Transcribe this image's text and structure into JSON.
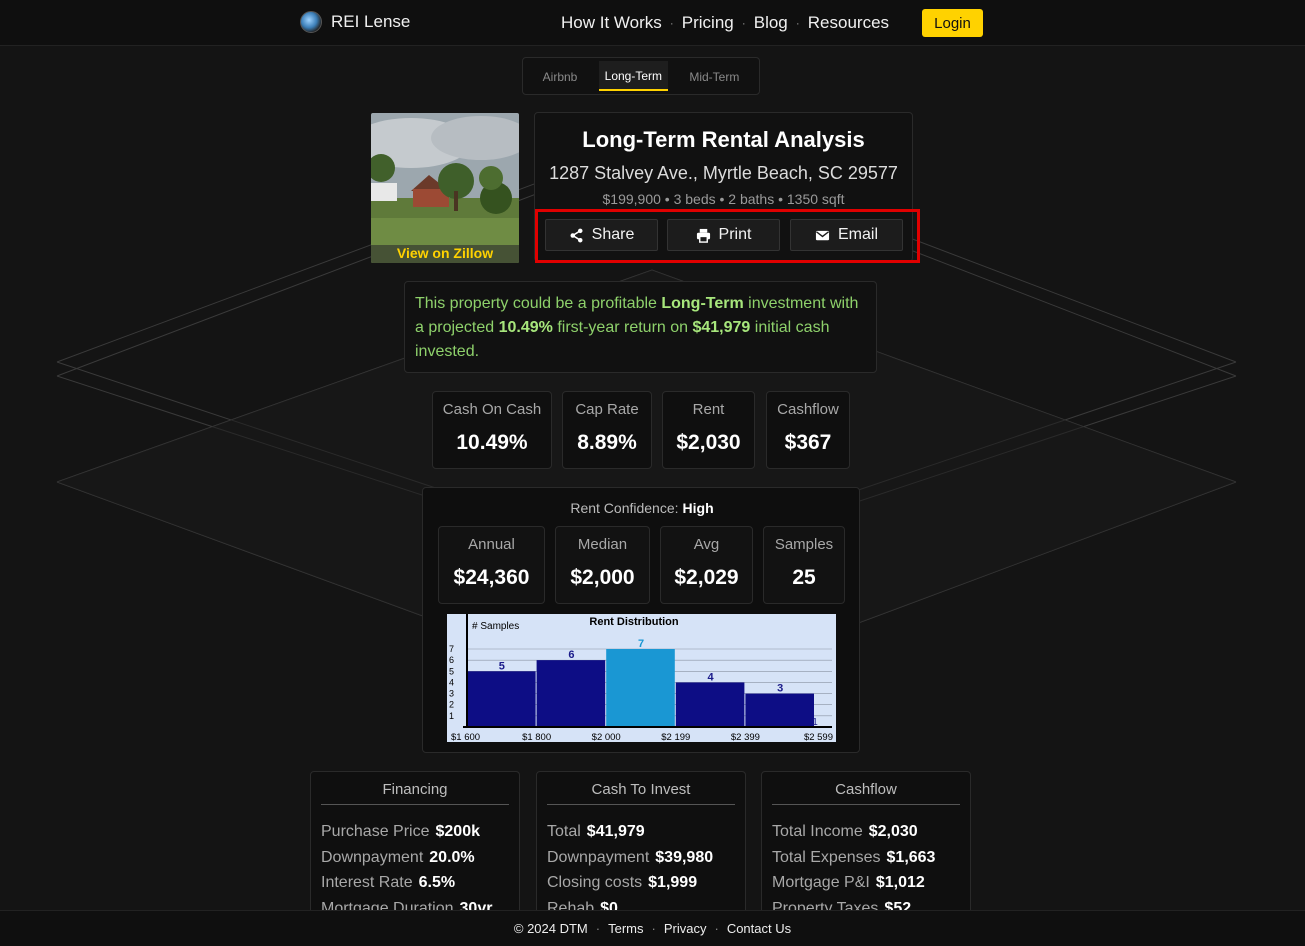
{
  "brand": {
    "name": "REI Lense"
  },
  "nav": {
    "items": [
      "How It Works",
      "Pricing",
      "Blog",
      "Resources"
    ],
    "separator": "·",
    "login_label": "Login"
  },
  "tabs": [
    {
      "label": "Airbnb",
      "active": false
    },
    {
      "label": "Long-Term",
      "active": true
    },
    {
      "label": "Mid-Term",
      "active": false
    }
  ],
  "property": {
    "zillow_link": "View on Zillow",
    "title": "Long-Term Rental Analysis",
    "address": "1287 Stalvey Ave., Myrtle Beach, SC 29577",
    "specs": "$199,900 • 3 beds • 2 baths • 1350 sqft"
  },
  "actions": {
    "share_label": "Share",
    "print_label": "Print",
    "email_label": "Email"
  },
  "summary": {
    "part1": "This property could be a profitable ",
    "strategy": "Long-Term",
    "part2": " investment with a projected ",
    "return_pct": "10.49%",
    "part3": " first-year return on ",
    "cash": "$41,979",
    "part4": " initial cash invested."
  },
  "metrics": [
    {
      "label": "Cash On Cash",
      "value": "10.49%"
    },
    {
      "label": "Cap Rate",
      "value": "8.89%"
    },
    {
      "label": "Rent",
      "value": "$2,030"
    },
    {
      "label": "Cashflow",
      "value": "$367"
    }
  ],
  "rent": {
    "confidence_label": "Rent Confidence:",
    "confidence_value": "High",
    "stats": [
      {
        "label": "Annual",
        "value": "$24,360"
      },
      {
        "label": "Median",
        "value": "$2,000"
      },
      {
        "label": "Avg",
        "value": "$2,029"
      },
      {
        "label": "Samples",
        "value": "25"
      }
    ]
  },
  "chart_data": {
    "type": "bar",
    "title": "Rent Distribution",
    "ylabel": "# Samples",
    "xlabel": "",
    "categories": [
      "$1 600",
      "$1 800",
      "$2 000",
      "$2 199",
      "$2 399"
    ],
    "x_tick_labels": [
      "$1 600",
      "$1 800",
      "$2 000",
      "$2 199",
      "$2 399",
      "$2 599"
    ],
    "values": [
      5,
      6,
      7,
      4,
      3
    ],
    "extra_label": "1",
    "highlight_index": 2,
    "y_ticks": [
      1,
      2,
      3,
      4,
      5,
      6,
      7
    ],
    "ylim": [
      0,
      7
    ],
    "grid": true,
    "colors": {
      "bar": "#0d0d85",
      "highlight": "#1a97d3",
      "background": "#d6e3f7"
    }
  },
  "cards": {
    "financing": {
      "title": "Financing",
      "rows": [
        {
          "label": "Purchase Price",
          "value": "$200k"
        },
        {
          "label": "Downpayment",
          "value": "20.0%"
        },
        {
          "label": "Interest Rate",
          "value": "6.5%"
        },
        {
          "label": "Mortgage Duration",
          "value": "30yr"
        }
      ]
    },
    "cash_to_invest": {
      "title": "Cash To Invest",
      "rows": [
        {
          "label": "Total",
          "value": "$41,979"
        },
        {
          "label": "Downpayment",
          "value": "$39,980"
        },
        {
          "label": "Closing costs",
          "value": "$1,999"
        },
        {
          "label": "Rehab",
          "value": "$0"
        }
      ]
    },
    "cashflow": {
      "title": "Cashflow",
      "rows": [
        {
          "label": "Total Income",
          "value": "$2,030"
        },
        {
          "label": "Total Expenses",
          "value": "$1,663"
        },
        {
          "label": "Mortgage P&I",
          "value": "$1,012"
        },
        {
          "label": "Property Taxes",
          "value": "$52"
        }
      ]
    }
  },
  "footer": {
    "copyright": "© 2024 DTM",
    "links": [
      "Terms",
      "Privacy",
      "Contact Us"
    ],
    "separator": "·"
  },
  "colors": {
    "accent": "#ffd200",
    "highlight_box": "#e00000",
    "positive": "#8ed16b"
  }
}
